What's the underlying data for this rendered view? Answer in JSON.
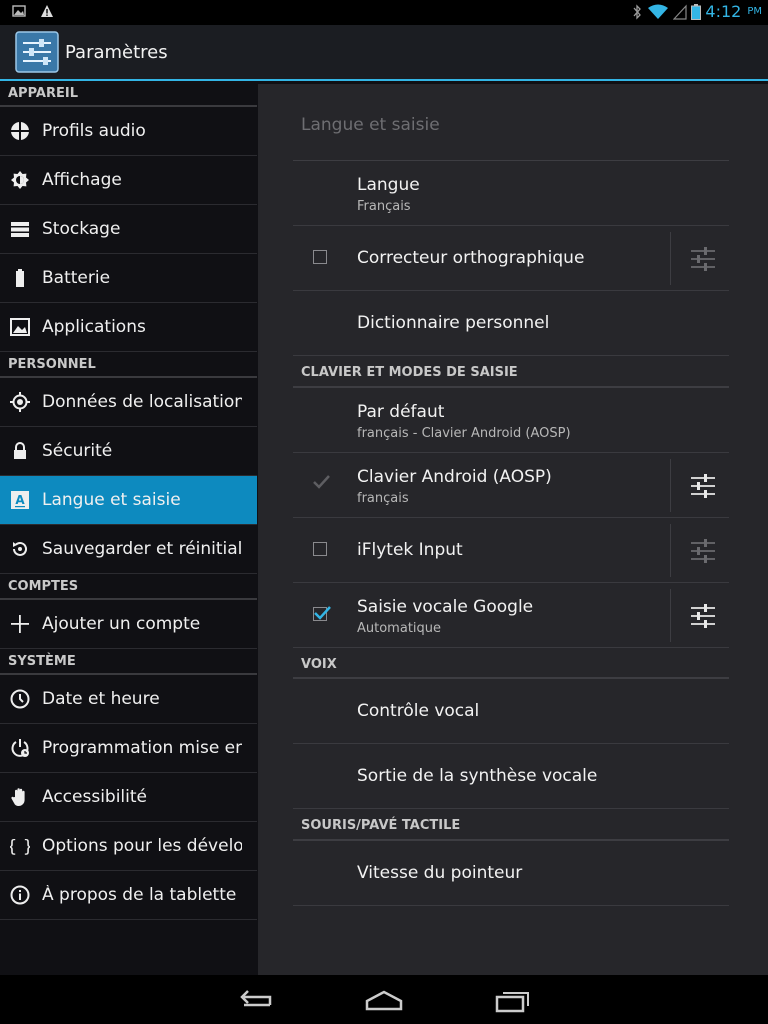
{
  "app": {
    "title": "Paramètres",
    "accent": "#33b5e5",
    "active_bg": "#0d8abf"
  },
  "status": {
    "time": "4:12",
    "ampm": "PM",
    "icons": [
      "image-icon",
      "warning-icon",
      "bluetooth-icon",
      "wifi-icon",
      "signal-icon",
      "battery-icon"
    ]
  },
  "sidebar": {
    "sections": [
      {
        "header": "APPAREIL",
        "items": [
          {
            "label": "Profils audio",
            "icon": "audio-profiles-icon"
          },
          {
            "label": "Affichage",
            "icon": "display-icon"
          },
          {
            "label": "Stockage",
            "icon": "storage-icon"
          },
          {
            "label": "Batterie",
            "icon": "battery-icon"
          },
          {
            "label": "Applications",
            "icon": "apps-icon"
          }
        ]
      },
      {
        "header": "PERSONNEL",
        "items": [
          {
            "label": "Données de localisation",
            "icon": "location-icon"
          },
          {
            "label": "Sécurité",
            "icon": "lock-icon"
          },
          {
            "label": "Langue et saisie",
            "icon": "language-icon",
            "active": true
          },
          {
            "label": "Sauvegarder et réinitialiser",
            "icon": "backup-icon"
          }
        ]
      },
      {
        "header": "COMPTES",
        "items": [
          {
            "label": "Ajouter un compte",
            "icon": "add-icon"
          }
        ]
      },
      {
        "header": "SYSTÈME",
        "items": [
          {
            "label": "Date et heure",
            "icon": "clock-icon"
          },
          {
            "label": "Programmation mise en marche",
            "icon": "power-schedule-icon"
          },
          {
            "label": "Accessibilité",
            "icon": "hand-icon"
          },
          {
            "label": "Options pour les développeurs",
            "icon": "braces-icon"
          },
          {
            "label": "À propos de la tablette",
            "icon": "info-icon"
          }
        ]
      }
    ]
  },
  "pane": {
    "title": "Langue et saisie",
    "groups": [
      {
        "header": "",
        "rows": [
          {
            "title": "Langue",
            "summary": "Français"
          },
          {
            "title": "Correcteur orthographique",
            "checkbox": "unchecked",
            "settings": "dim"
          },
          {
            "title": "Dictionnaire personnel"
          }
        ]
      },
      {
        "header": "CLAVIER ET MODES DE SAISIE",
        "rows": [
          {
            "title": "Par défaut",
            "summary": "français - Clavier Android (AOSP)"
          },
          {
            "title": "Clavier Android (AOSP)",
            "summary": "français",
            "checkbox": "checked-disabled",
            "settings": "bright"
          },
          {
            "title": "iFlytek Input",
            "checkbox": "unchecked",
            "settings": "dim"
          },
          {
            "title": "Saisie vocale Google",
            "summary": "Automatique",
            "checkbox": "checked",
            "settings": "bright"
          }
        ]
      },
      {
        "header": "VOIX",
        "rows": [
          {
            "title": "Contrôle vocal"
          },
          {
            "title": "Sortie de la synthèse vocale"
          }
        ]
      },
      {
        "header": "SOURIS/PAVÉ TACTILE",
        "rows": [
          {
            "title": "Vitesse du pointeur"
          }
        ]
      }
    ]
  },
  "navbar": {
    "buttons": [
      "back-icon",
      "home-icon",
      "recents-icon"
    ]
  }
}
